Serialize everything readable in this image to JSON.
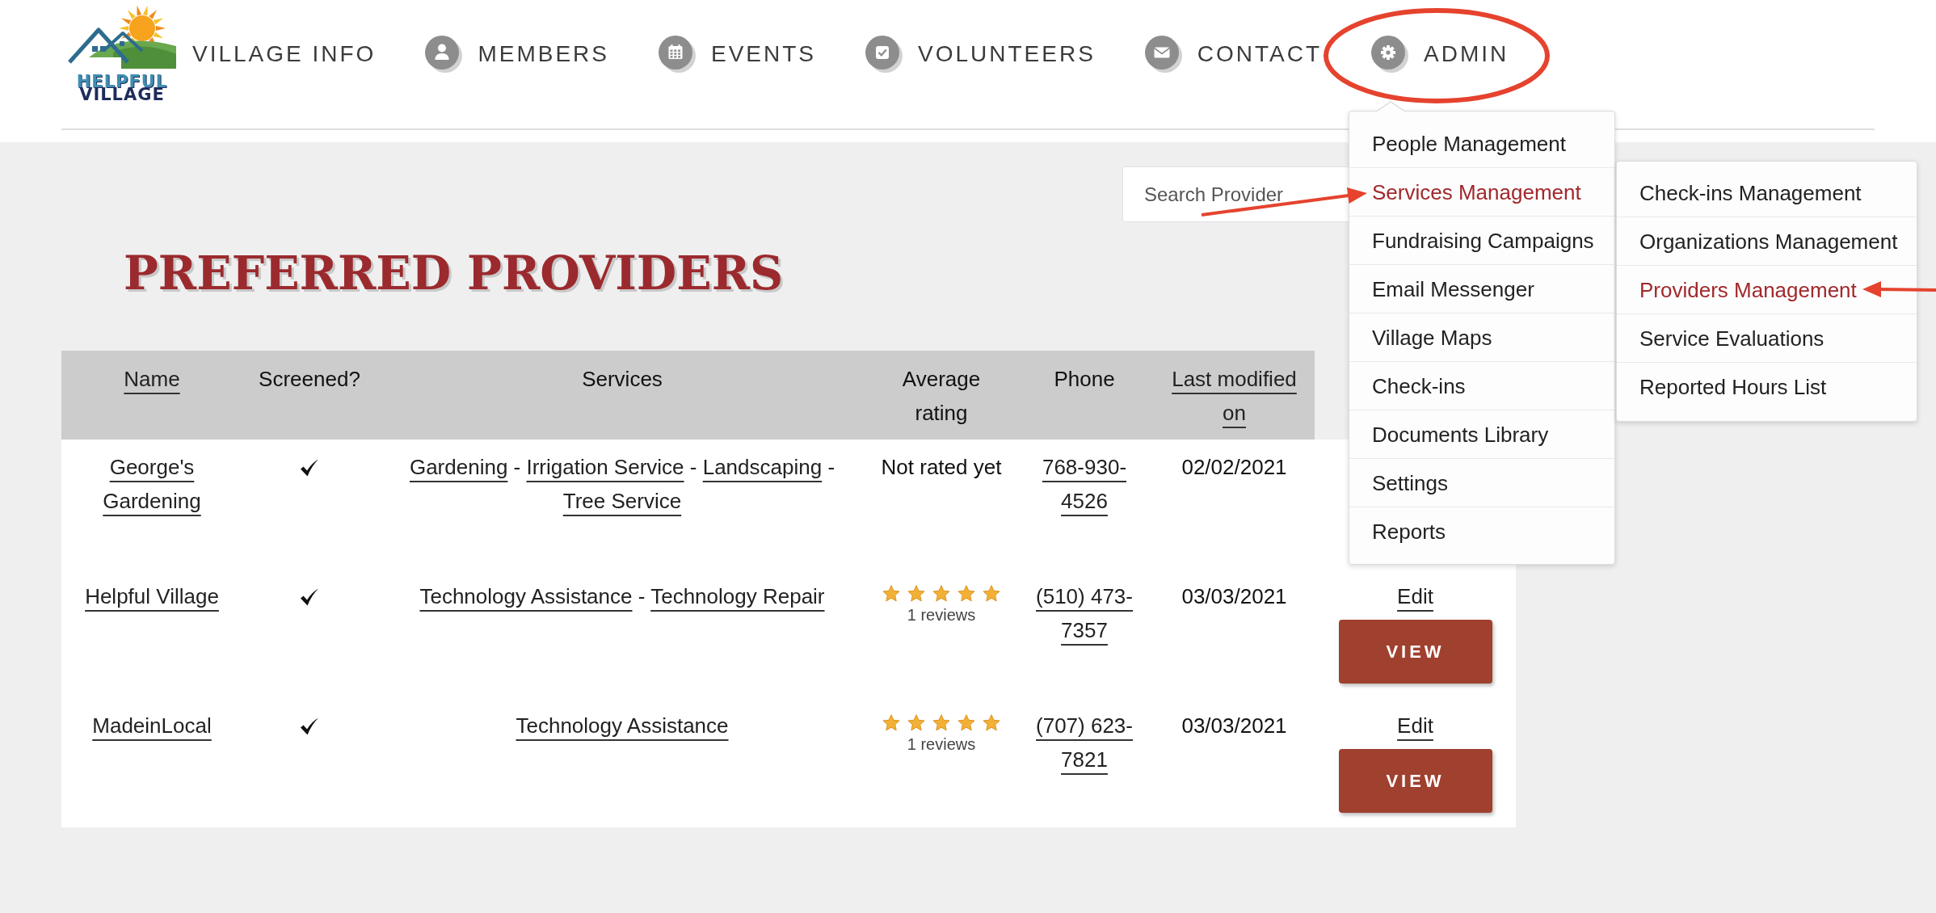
{
  "header": {
    "logo": {
      "line1": "HELPFUL",
      "line2": "VILLAGE"
    },
    "nav": [
      {
        "kind": "plain",
        "label": "VILLAGE INFO"
      },
      {
        "kind": "person",
        "label": "MEMBERS"
      },
      {
        "kind": "calendar",
        "label": "EVENTS"
      },
      {
        "kind": "checkbox",
        "label": "VOLUNTEERS"
      },
      {
        "kind": "envelope",
        "label": "CONTACT"
      },
      {
        "kind": "gear",
        "label": "ADMIN",
        "menu": [
          {
            "label": "People Management",
            "selected": false
          },
          {
            "label": "Services Management",
            "selected": true,
            "children": [
              {
                "label": "Check-ins Management",
                "selected": false
              },
              {
                "label": "Organizations Management",
                "selected": false
              },
              {
                "label": "Providers Management",
                "selected": true
              },
              {
                "label": "Service Evaluations",
                "selected": false
              },
              {
                "label": "Reported Hours List",
                "selected": false
              }
            ]
          },
          {
            "label": "Fundraising Campaigns",
            "selected": false
          },
          {
            "label": "Email Messenger",
            "selected": false
          },
          {
            "label": "Village Maps",
            "selected": false
          },
          {
            "label": "Check-ins",
            "selected": false
          },
          {
            "label": "Documents Library",
            "selected": false
          },
          {
            "label": "Settings",
            "selected": false
          },
          {
            "label": "Reports",
            "selected": false
          }
        ]
      }
    ]
  },
  "search": {
    "placeholder": "Search Provider"
  },
  "title": "PREFERRED PROVIDERS",
  "table": {
    "columns": [
      {
        "label": "Name",
        "sortable": true
      },
      {
        "label": "Screened?",
        "sortable": false
      },
      {
        "label": "Services",
        "sortable": false
      },
      {
        "label": "Average rating",
        "sortable": false
      },
      {
        "label": "Phone",
        "sortable": false
      },
      {
        "label": "Last modified on",
        "sortable": true
      }
    ],
    "service_separator": "-",
    "rows": [
      {
        "name": "George's Gardening",
        "screened": true,
        "services": [
          "Gardening",
          "Irrigation Service",
          "Landscaping",
          "Tree Service"
        ],
        "rating": {
          "kind": "text",
          "label": "Not rated yet"
        },
        "phone": "768-930-4526",
        "modified": "02/02/2021"
      },
      {
        "name": "Helpful Village",
        "screened": true,
        "services": [
          "Technology Assistance",
          "Technology Repair"
        ],
        "rating": {
          "kind": "stars",
          "stars": 5,
          "reviews": "1 reviews"
        },
        "phone": "(510) 473-7357",
        "modified": "03/03/2021",
        "actions": [
          {
            "kind": "link",
            "label": "Edit"
          },
          {
            "kind": "button",
            "label": "VIEW"
          }
        ]
      },
      {
        "name": "MadeinLocal",
        "screened": true,
        "services": [
          "Technology Assistance"
        ],
        "rating": {
          "kind": "stars",
          "stars": 5,
          "reviews": "1 reviews"
        },
        "phone": "(707) 623-7821",
        "modified": "03/03/2021",
        "actions": [
          {
            "kind": "link",
            "label": "Edit"
          },
          {
            "kind": "button",
            "label": "VIEW"
          }
        ]
      }
    ]
  }
}
